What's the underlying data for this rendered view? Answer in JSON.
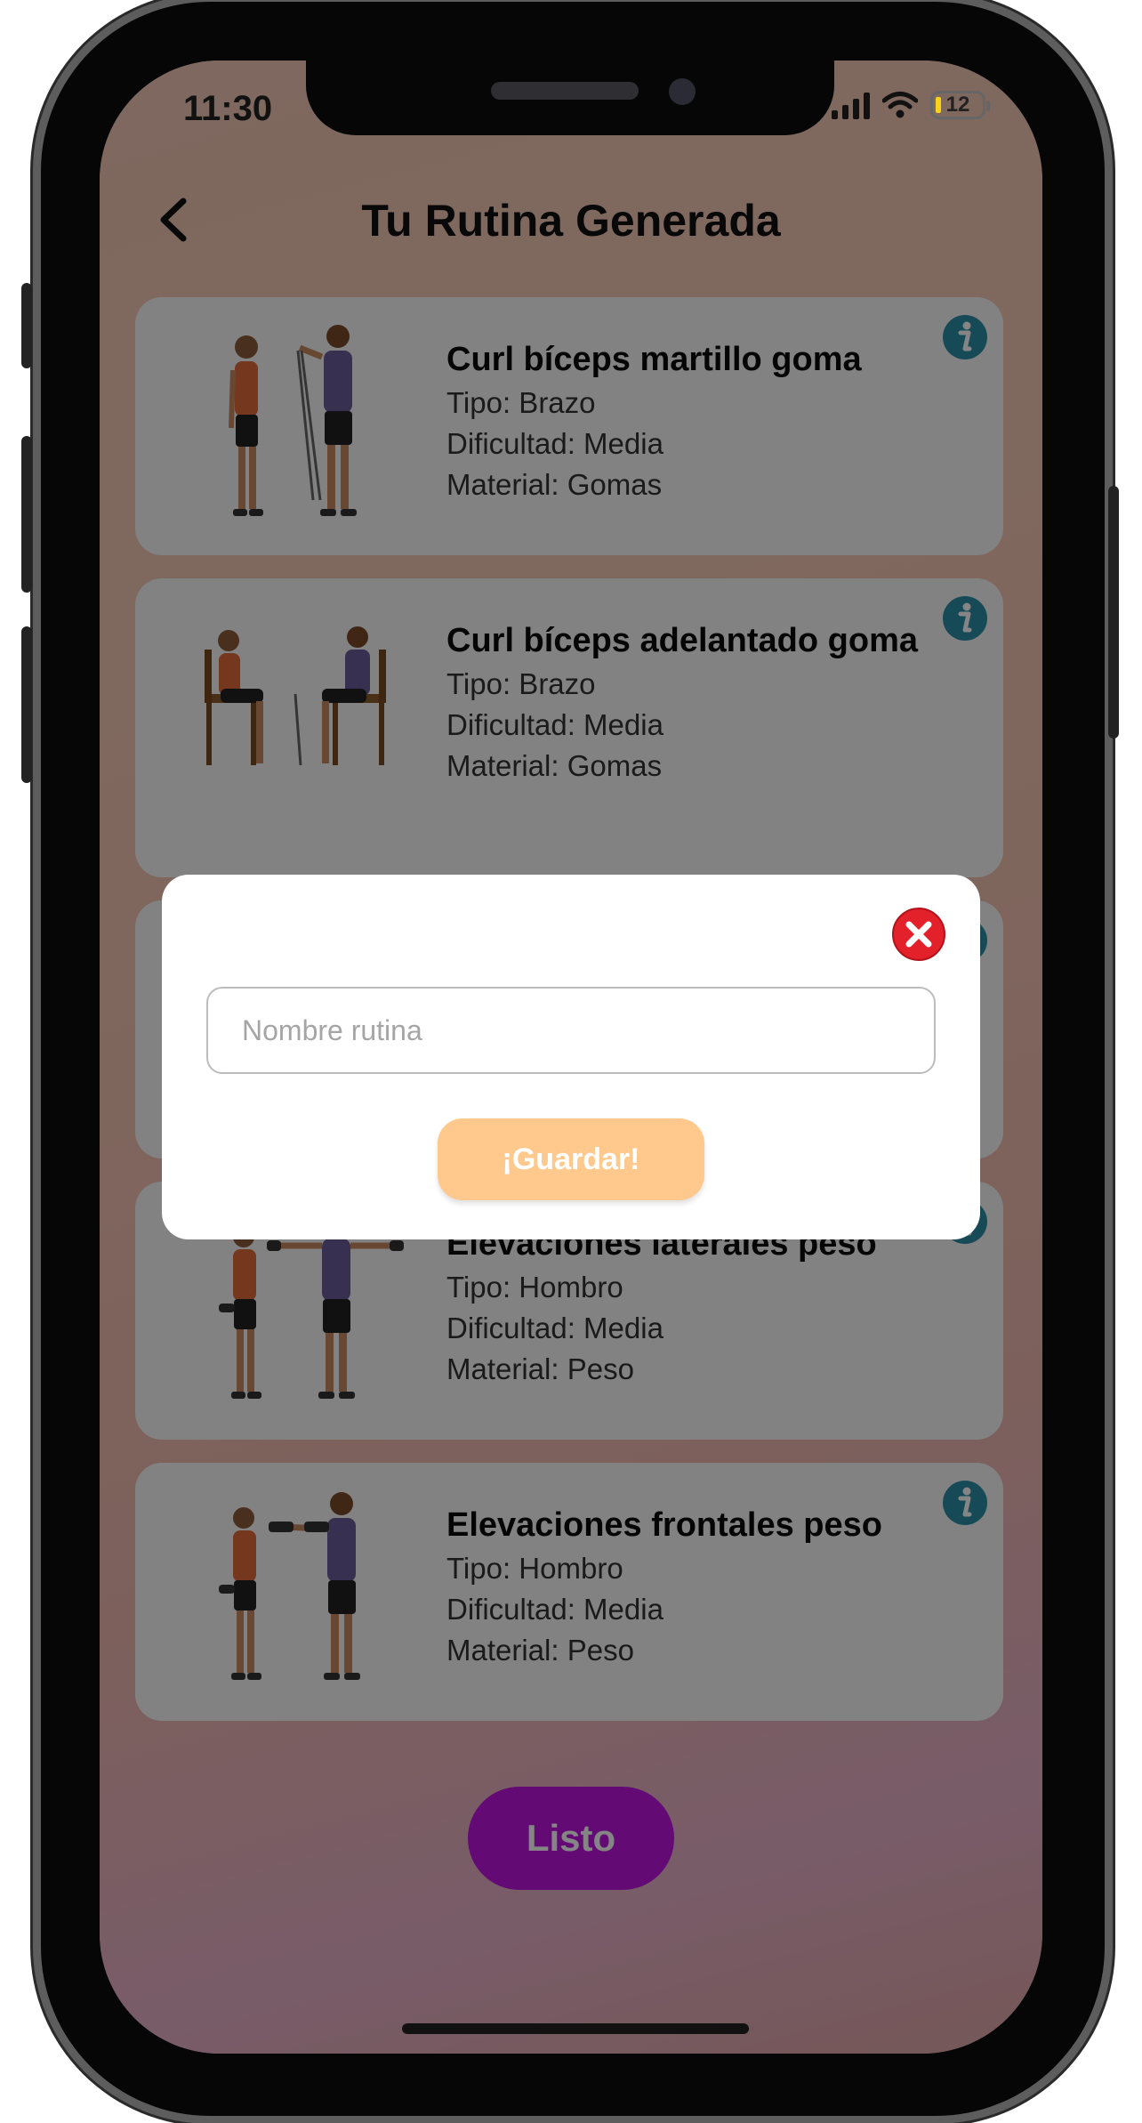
{
  "status_bar": {
    "time": "11:30",
    "battery": "12"
  },
  "header": {
    "title": "Tu Rutina Generada"
  },
  "exercises": [
    {
      "name": "Curl bíceps martillo goma",
      "type": "Tipo: Brazo",
      "difficulty": "Dificultad: Media",
      "material": "Material: Gomas"
    },
    {
      "name": "Curl bíceps adelantado goma",
      "type": "Tipo: Brazo",
      "difficulty": "Dificultad: Media",
      "material": "Material: Gomas"
    },
    {
      "name": "",
      "type": "",
      "difficulty": "",
      "material": ""
    },
    {
      "name": "Elevaciones laterales peso",
      "type": "Tipo: Hombro",
      "difficulty": "Dificultad: Media",
      "material": "Material: Peso"
    },
    {
      "name": "Elevaciones frontales peso",
      "type": "Tipo: Hombro",
      "difficulty": "Dificultad: Media",
      "material": "Material: Peso"
    }
  ],
  "modal": {
    "input_placeholder": "Nombre rutina",
    "input_value": "",
    "save_label": "¡Guardar!"
  },
  "done_label": "Listo",
  "colors": {
    "accent": "#be14e0",
    "save_button": "#ffc98e",
    "info_icon": "#2d8ea8",
    "close_icon": "#e2212b"
  }
}
